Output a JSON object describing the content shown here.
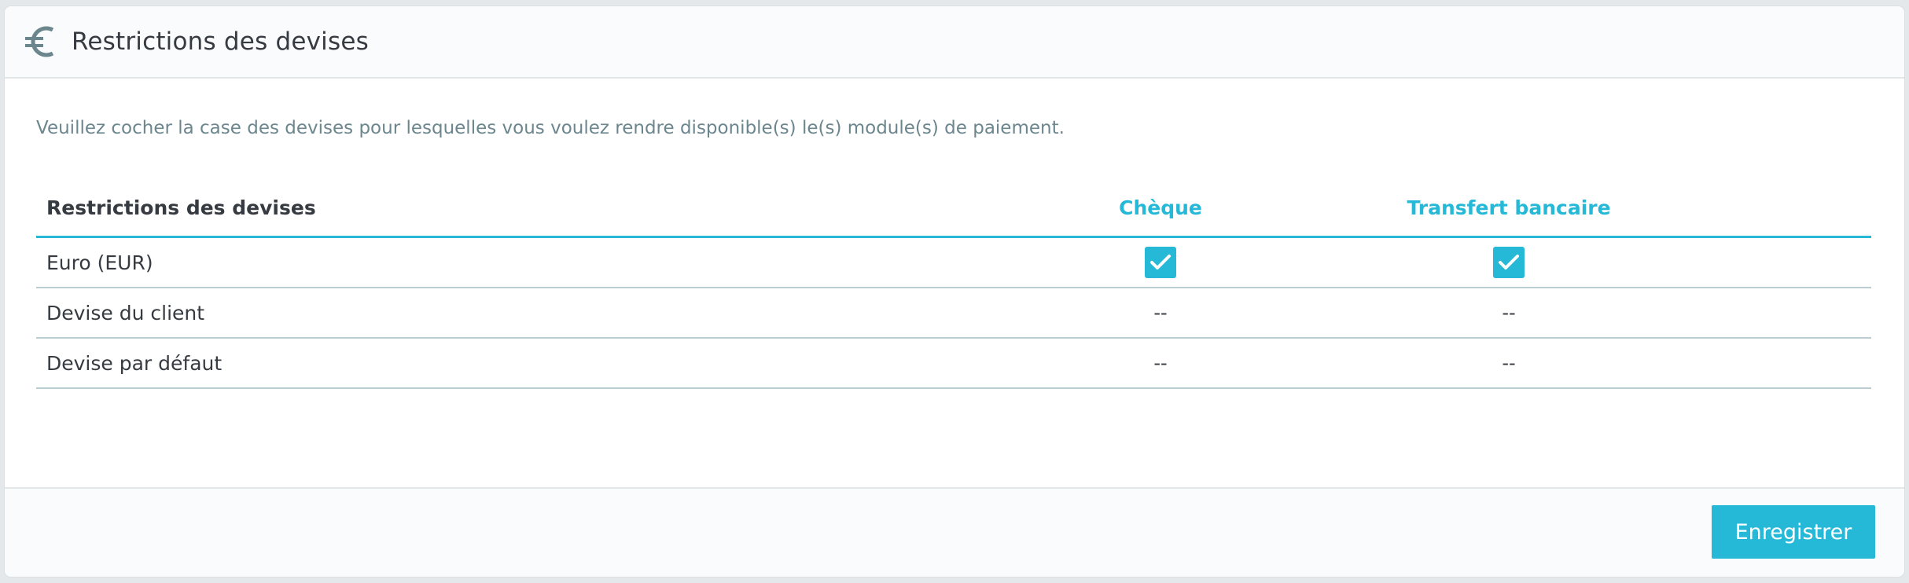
{
  "header": {
    "icon": "euro-icon",
    "title": "Restrictions des devises"
  },
  "description": "Veuillez cocher la case des devises pour lesquelles vous voulez rendre disponible(s) le(s) module(s) de paiement.",
  "table": {
    "columns": [
      "Restrictions des devises",
      "Chèque",
      "Transfert bancaire"
    ],
    "rows": [
      {
        "label": "Euro (EUR)",
        "cheque": true,
        "transfert": true
      },
      {
        "label": "Devise du client",
        "cheque": "--",
        "transfert": "--"
      },
      {
        "label": "Devise par défaut",
        "cheque": "--",
        "transfert": "--"
      }
    ]
  },
  "footer": {
    "save_label": "Enregistrer"
  },
  "colors": {
    "accent": "#25b9d7",
    "text": "#363a41",
    "muted": "#6c868e"
  }
}
